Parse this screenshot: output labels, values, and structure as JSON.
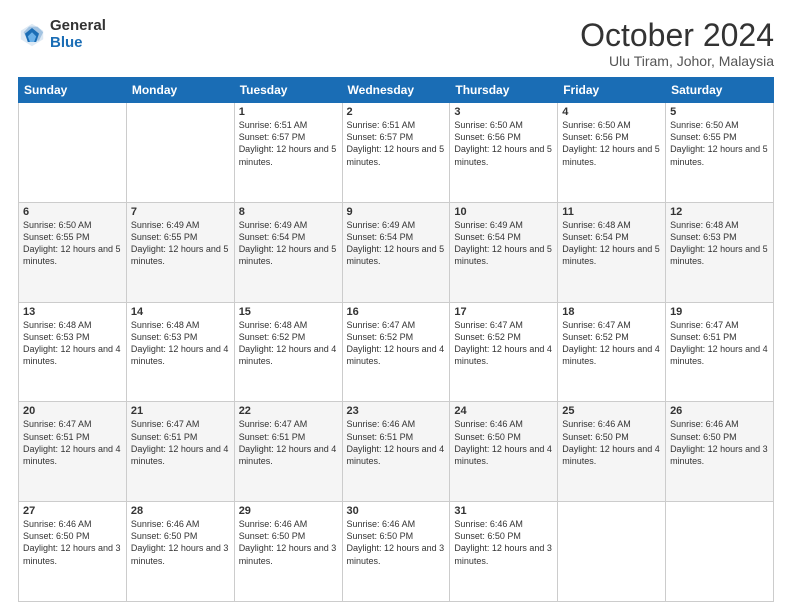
{
  "logo": {
    "general": "General",
    "blue": "Blue"
  },
  "header": {
    "month": "October 2024",
    "location": "Ulu Tiram, Johor, Malaysia"
  },
  "weekdays": [
    "Sunday",
    "Monday",
    "Tuesday",
    "Wednesday",
    "Thursday",
    "Friday",
    "Saturday"
  ],
  "weeks": [
    [
      {
        "day": "",
        "info": ""
      },
      {
        "day": "",
        "info": ""
      },
      {
        "day": "1",
        "info": "Sunrise: 6:51 AM\nSunset: 6:57 PM\nDaylight: 12 hours and 5 minutes."
      },
      {
        "day": "2",
        "info": "Sunrise: 6:51 AM\nSunset: 6:57 PM\nDaylight: 12 hours and 5 minutes."
      },
      {
        "day": "3",
        "info": "Sunrise: 6:50 AM\nSunset: 6:56 PM\nDaylight: 12 hours and 5 minutes."
      },
      {
        "day": "4",
        "info": "Sunrise: 6:50 AM\nSunset: 6:56 PM\nDaylight: 12 hours and 5 minutes."
      },
      {
        "day": "5",
        "info": "Sunrise: 6:50 AM\nSunset: 6:55 PM\nDaylight: 12 hours and 5 minutes."
      }
    ],
    [
      {
        "day": "6",
        "info": "Sunrise: 6:50 AM\nSunset: 6:55 PM\nDaylight: 12 hours and 5 minutes."
      },
      {
        "day": "7",
        "info": "Sunrise: 6:49 AM\nSunset: 6:55 PM\nDaylight: 12 hours and 5 minutes."
      },
      {
        "day": "8",
        "info": "Sunrise: 6:49 AM\nSunset: 6:54 PM\nDaylight: 12 hours and 5 minutes."
      },
      {
        "day": "9",
        "info": "Sunrise: 6:49 AM\nSunset: 6:54 PM\nDaylight: 12 hours and 5 minutes."
      },
      {
        "day": "10",
        "info": "Sunrise: 6:49 AM\nSunset: 6:54 PM\nDaylight: 12 hours and 5 minutes."
      },
      {
        "day": "11",
        "info": "Sunrise: 6:48 AM\nSunset: 6:54 PM\nDaylight: 12 hours and 5 minutes."
      },
      {
        "day": "12",
        "info": "Sunrise: 6:48 AM\nSunset: 6:53 PM\nDaylight: 12 hours and 5 minutes."
      }
    ],
    [
      {
        "day": "13",
        "info": "Sunrise: 6:48 AM\nSunset: 6:53 PM\nDaylight: 12 hours and 4 minutes."
      },
      {
        "day": "14",
        "info": "Sunrise: 6:48 AM\nSunset: 6:53 PM\nDaylight: 12 hours and 4 minutes."
      },
      {
        "day": "15",
        "info": "Sunrise: 6:48 AM\nSunset: 6:52 PM\nDaylight: 12 hours and 4 minutes."
      },
      {
        "day": "16",
        "info": "Sunrise: 6:47 AM\nSunset: 6:52 PM\nDaylight: 12 hours and 4 minutes."
      },
      {
        "day": "17",
        "info": "Sunrise: 6:47 AM\nSunset: 6:52 PM\nDaylight: 12 hours and 4 minutes."
      },
      {
        "day": "18",
        "info": "Sunrise: 6:47 AM\nSunset: 6:52 PM\nDaylight: 12 hours and 4 minutes."
      },
      {
        "day": "19",
        "info": "Sunrise: 6:47 AM\nSunset: 6:51 PM\nDaylight: 12 hours and 4 minutes."
      }
    ],
    [
      {
        "day": "20",
        "info": "Sunrise: 6:47 AM\nSunset: 6:51 PM\nDaylight: 12 hours and 4 minutes."
      },
      {
        "day": "21",
        "info": "Sunrise: 6:47 AM\nSunset: 6:51 PM\nDaylight: 12 hours and 4 minutes."
      },
      {
        "day": "22",
        "info": "Sunrise: 6:47 AM\nSunset: 6:51 PM\nDaylight: 12 hours and 4 minutes."
      },
      {
        "day": "23",
        "info": "Sunrise: 6:46 AM\nSunset: 6:51 PM\nDaylight: 12 hours and 4 minutes."
      },
      {
        "day": "24",
        "info": "Sunrise: 6:46 AM\nSunset: 6:50 PM\nDaylight: 12 hours and 4 minutes."
      },
      {
        "day": "25",
        "info": "Sunrise: 6:46 AM\nSunset: 6:50 PM\nDaylight: 12 hours and 4 minutes."
      },
      {
        "day": "26",
        "info": "Sunrise: 6:46 AM\nSunset: 6:50 PM\nDaylight: 12 hours and 3 minutes."
      }
    ],
    [
      {
        "day": "27",
        "info": "Sunrise: 6:46 AM\nSunset: 6:50 PM\nDaylight: 12 hours and 3 minutes."
      },
      {
        "day": "28",
        "info": "Sunrise: 6:46 AM\nSunset: 6:50 PM\nDaylight: 12 hours and 3 minutes."
      },
      {
        "day": "29",
        "info": "Sunrise: 6:46 AM\nSunset: 6:50 PM\nDaylight: 12 hours and 3 minutes."
      },
      {
        "day": "30",
        "info": "Sunrise: 6:46 AM\nSunset: 6:50 PM\nDaylight: 12 hours and 3 minutes."
      },
      {
        "day": "31",
        "info": "Sunrise: 6:46 AM\nSunset: 6:50 PM\nDaylight: 12 hours and 3 minutes."
      },
      {
        "day": "",
        "info": ""
      },
      {
        "day": "",
        "info": ""
      }
    ]
  ]
}
